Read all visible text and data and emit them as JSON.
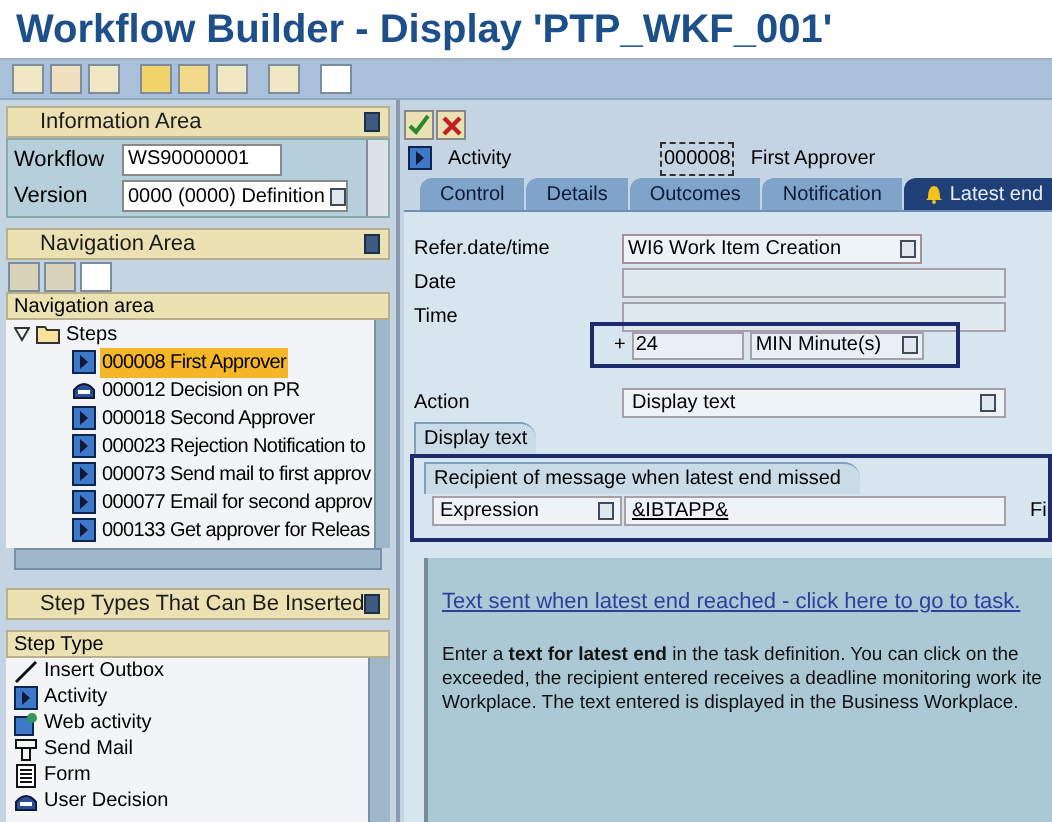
{
  "window": {
    "title": "Workflow Builder - Display 'PTP_WKF_001'"
  },
  "information_area": {
    "title": "Information Area",
    "fields": [
      {
        "label": "Workflow",
        "value": "WS90000001",
        "kind": "text"
      },
      {
        "label": "Version",
        "value": "0000 (0000) Definition",
        "kind": "dropdown"
      }
    ]
  },
  "navigation_area": {
    "title": "Navigation Area",
    "header": "Navigation area",
    "tree": {
      "label": "Steps",
      "expanded": true,
      "children": [
        {
          "label": "000008 First Approver",
          "kind": "activity",
          "selected": true
        },
        {
          "label": "000012 Decision on PR",
          "kind": "decision",
          "selected": false
        },
        {
          "label": "000018 Second Approver",
          "kind": "activity",
          "selected": false
        },
        {
          "label": "000023 Rejection Notification to",
          "kind": "activity",
          "selected": false
        },
        {
          "label": "000073 Send mail to first approv",
          "kind": "activity",
          "selected": false
        },
        {
          "label": "000077 Email for second approv",
          "kind": "activity",
          "selected": false
        },
        {
          "label": "000133 Get approver for Releas",
          "kind": "activity",
          "selected": false
        }
      ]
    }
  },
  "step_types": {
    "title": "Step Types That Can Be Inserted",
    "header": "Step Type",
    "items": [
      {
        "label": "Insert Outbox",
        "kind": "line"
      },
      {
        "label": "Activity",
        "kind": "activity"
      },
      {
        "label": "Web activity",
        "kind": "web"
      },
      {
        "label": "Send Mail",
        "kind": "mail"
      },
      {
        "label": "Form",
        "kind": "form"
      },
      {
        "label": "User Decision",
        "kind": "decision"
      }
    ]
  },
  "detail": {
    "step_type": "Activity",
    "step_number": "000008",
    "step_name": "First Approver",
    "tabs": [
      {
        "label": "Control",
        "selected": false
      },
      {
        "label": "Details",
        "selected": false
      },
      {
        "label": "Outcomes",
        "selected": false
      },
      {
        "label": "Notification",
        "selected": false
      },
      {
        "label": "Latest end",
        "selected": true
      }
    ],
    "reference": {
      "label": "Refer.date/time",
      "value": "WI6 Work Item Creation"
    },
    "date_label": "Date",
    "time_label": "Time",
    "offset": {
      "sign": "+",
      "value": "24",
      "unit": "MIN Minute(s)"
    },
    "action": {
      "label": "Action",
      "value": "Display text"
    },
    "section_tab": "Display text",
    "recipient": {
      "title": "Recipient of message when latest end missed",
      "type": "Expression",
      "value": "&IBTAPP&",
      "trailing": "Fi"
    },
    "link": "Text sent when latest end reached - click here to go to task.",
    "paragraph": [
      "Enter a **text for latest end** in the task definition. You can click on the",
      "exceeded, the recipient entered receives a deadline monitoring work ite",
      "Workplace. The text entered is displayed in the Business Workplace."
    ]
  }
}
